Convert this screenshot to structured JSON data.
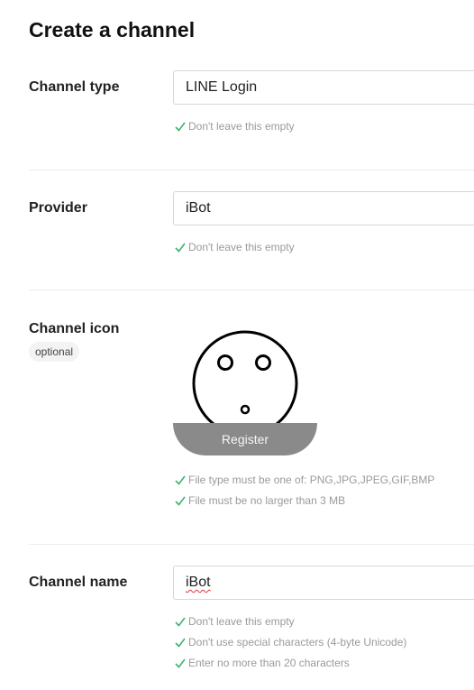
{
  "page": {
    "title": "Create a channel"
  },
  "fields": {
    "channel_type": {
      "label": "Channel type",
      "value": "LINE Login",
      "messages": [
        "Don't leave this empty"
      ]
    },
    "provider": {
      "label": "Provider",
      "value": "iBot",
      "messages": [
        "Don't leave this empty"
      ]
    },
    "channel_icon": {
      "label": "Channel icon",
      "optional_badge": "optional",
      "button_label": "Register",
      "messages": [
        "File type must be one of: PNG,JPG,JPEG,GIF,BMP",
        "File must be no larger than 3 MB"
      ]
    },
    "channel_name": {
      "label": "Channel name",
      "value": "iBot",
      "messages": [
        "Don't leave this empty",
        "Don't use special characters (4-byte Unicode)",
        "Enter no more than 20 characters"
      ]
    }
  },
  "colors": {
    "check": "#3cb371",
    "hint_text": "#9a9a9a",
    "register_bg": "#8a8a8a"
  },
  "icons": {
    "check": "check-icon",
    "avatar": "face-drawing"
  }
}
